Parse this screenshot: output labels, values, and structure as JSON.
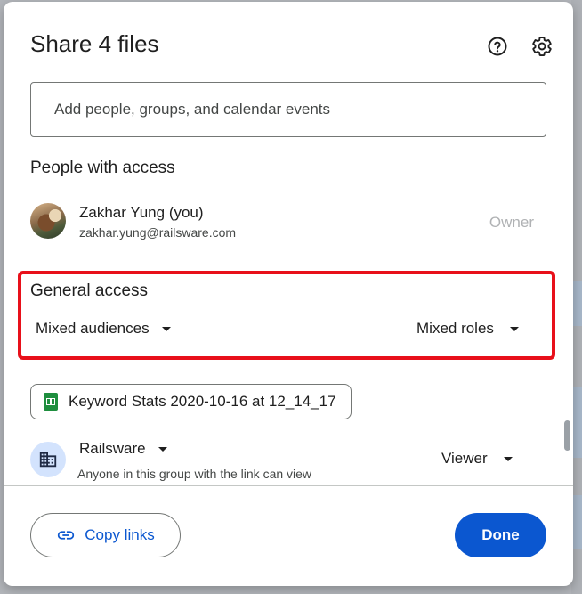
{
  "dialog": {
    "title": "Share 4 files",
    "help_icon": "help-circle-icon",
    "settings_icon": "gear-icon"
  },
  "add_people": {
    "placeholder": "Add people, groups, and calendar events"
  },
  "people_with_access": {
    "title": "People with access",
    "people": [
      {
        "name": "Zakhar Yung (you)",
        "email": "zakhar.yung@railsware.com",
        "role": "Owner"
      }
    ]
  },
  "general_access": {
    "title": "General access",
    "audience_label": "Mixed audiences",
    "roles_label": "Mixed roles",
    "highlight_color": "#e8101a"
  },
  "file": {
    "name": "Keyword Stats 2020-10-16 at 12_14_17",
    "icon": "google-sheets-icon",
    "group": {
      "name": "Railsware",
      "description": "Anyone in this group with the link can view",
      "role": "Viewer",
      "icon": "domain-building-icon"
    }
  },
  "footer": {
    "copy_links_label": "Copy links",
    "done_label": "Done",
    "accent_color": "#0b57d0"
  }
}
